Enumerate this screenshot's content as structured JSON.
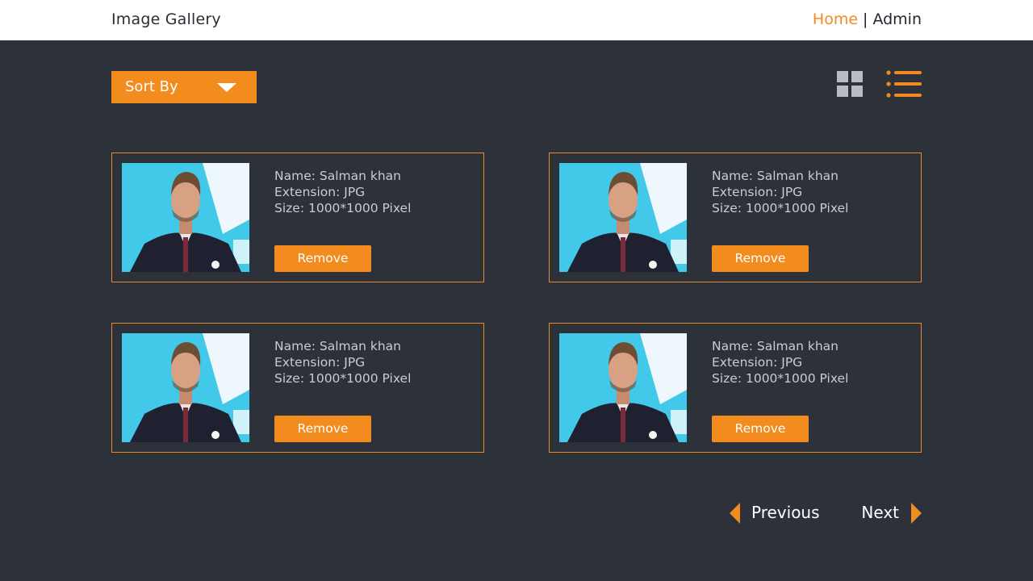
{
  "header": {
    "title": "Image Gallery",
    "nav": {
      "home": "Home",
      "separator": "|",
      "admin": "Admin"
    }
  },
  "toolbar": {
    "sort_label": "Sort By",
    "grid_view_icon": "grid-icon",
    "list_view_icon": "list-icon"
  },
  "gallery": {
    "items": [
      {
        "name": "Name: Salman khan",
        "extension": "Extension: JPG",
        "size": "Size: 1000*1000 Pixel",
        "remove_label": "Remove"
      },
      {
        "name": "Name: Salman khan",
        "extension": "Extension: JPG",
        "size": "Size: 1000*1000 Pixel",
        "remove_label": "Remove"
      },
      {
        "name": "Name: Salman khan",
        "extension": "Extension: JPG",
        "size": "Size: 1000*1000 Pixel",
        "remove_label": "Remove"
      },
      {
        "name": "Name: Salman khan",
        "extension": "Extension: JPG",
        "size": "Size: 1000*1000 Pixel",
        "remove_label": "Remove"
      }
    ]
  },
  "pagination": {
    "previous": "Previous",
    "next": "Next"
  },
  "colors": {
    "accent": "#f28c1e",
    "background": "#2c313a",
    "header": "#ffffff",
    "text_muted": "#c9ccd2"
  }
}
